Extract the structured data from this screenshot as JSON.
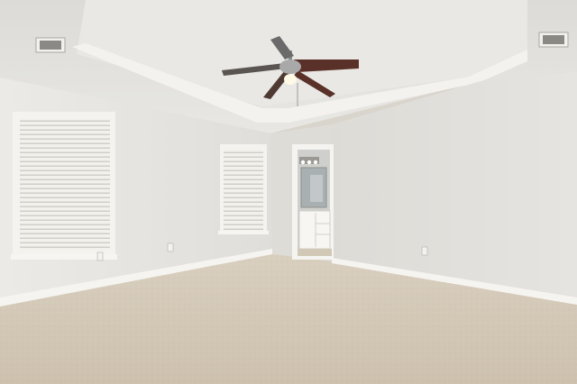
{
  "scene": {
    "colors": {
      "ceiling": "#e4e3df",
      "tray_ceiling": "#ebeae6",
      "left_wall": "#e7e5e1",
      "right_wall": "#e2e0dc",
      "back_wall": "#d8d6d1",
      "carpet": "#d3c8b6",
      "baseboard": "#f4f3ef",
      "fan_blade": "#5a3128"
    },
    "objects": [
      "ceiling-fan",
      "tray-ceiling",
      "air-vent-left",
      "air-vent-right",
      "window-left",
      "window-middle",
      "bathroom-doorway",
      "bathroom-vanity",
      "bathroom-mirror",
      "vanity-light",
      "carpet-floor",
      "electrical-outlet"
    ]
  }
}
